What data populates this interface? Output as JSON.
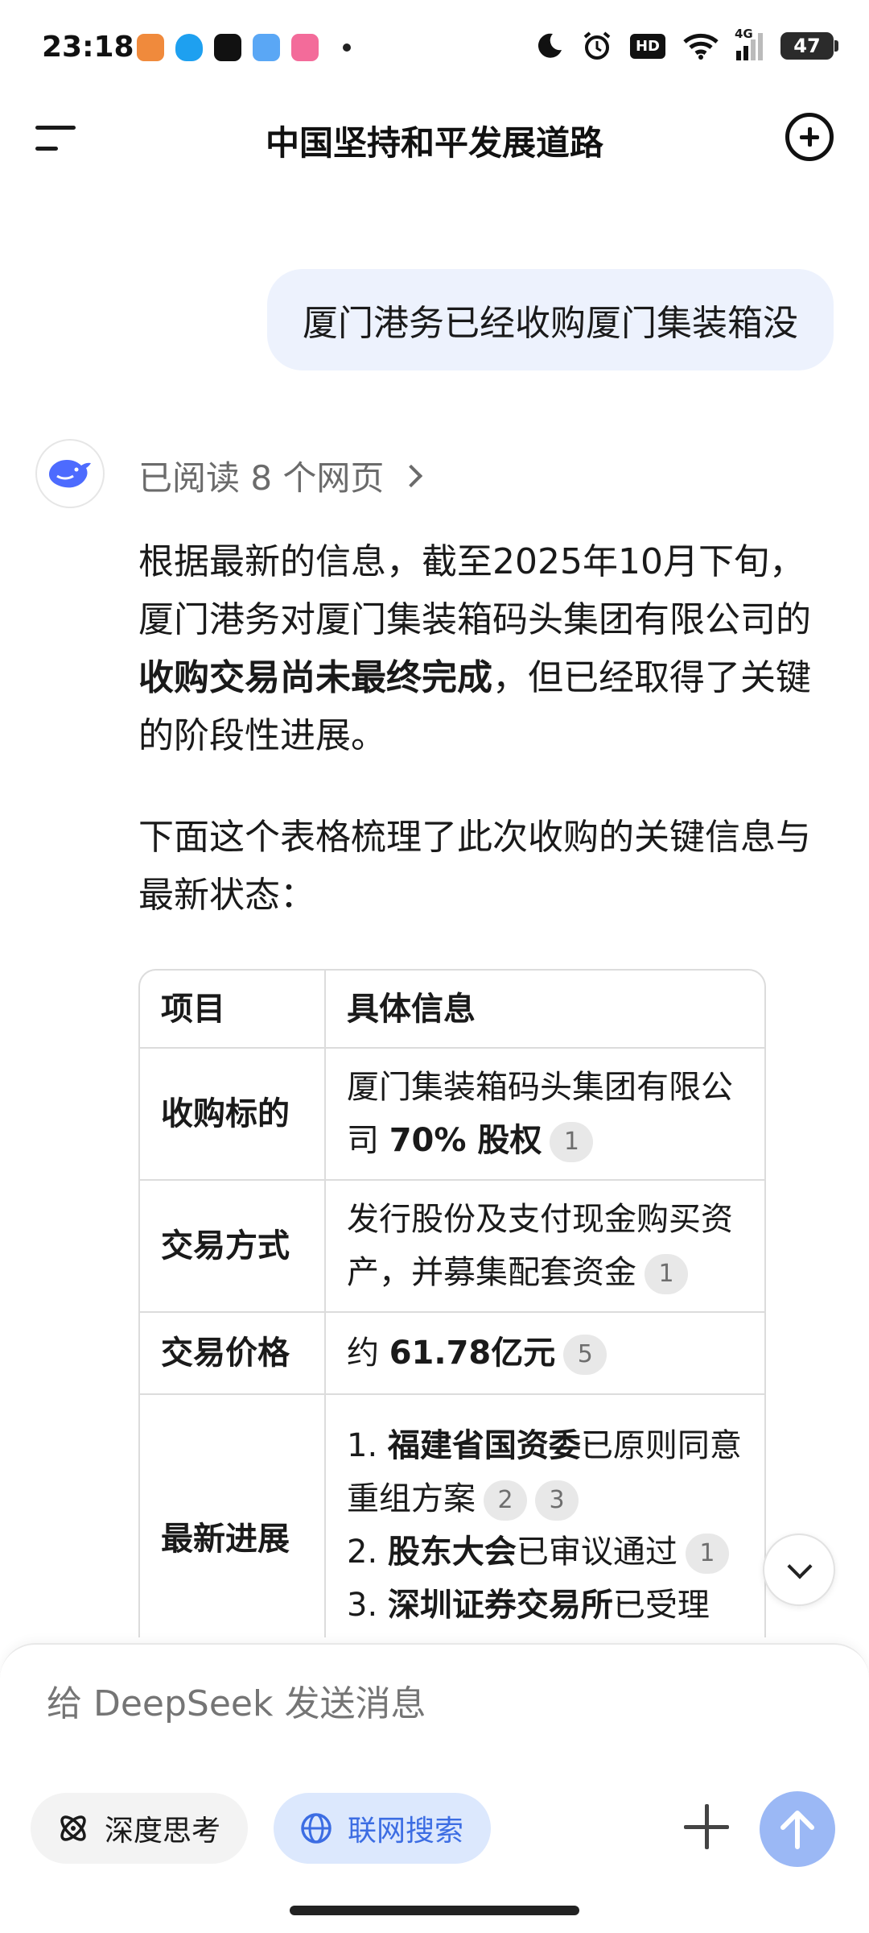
{
  "status_bar": {
    "time": "23:18",
    "battery": "47",
    "network": "4G",
    "icons": [
      "game-app-icon",
      "qq-icon",
      "tiktok-icon",
      "weather-icon",
      "bilibili-icon",
      "moon-icon",
      "alarm-icon",
      "hd-icon",
      "wifi-icon",
      "signal-icon",
      "battery-icon"
    ],
    "hd": "HD"
  },
  "header": {
    "title": "中国坚持和平发展道路"
  },
  "user_message": "厦门港务已经收购厦门集装箱没",
  "assistant": {
    "read_pages": "已阅读 8 个网页",
    "para1_a": "根据最新的信息，截至2025年10月下旬，厦门港务对厦门集装箱码头集团有限公司的",
    "para1_bold": "收购交易尚未最终完成",
    "para1_b": "，但已经取得了关键的阶段性进展。",
    "para2": "下面这个表格梳理了此次收购的关键信息与最新状态：",
    "table": {
      "header": [
        "项目",
        "具体信息"
      ],
      "row1_label": "收购标的",
      "row1_text": "厦门集装箱码头集团有限公司 ",
      "row1_bold": "70% 股权",
      "row1_ref": "1",
      "row2_label": "交易方式",
      "row2_text": "发行股份及支付现金购买资产，并募集配套资金",
      "row2_ref": "1",
      "row3_label": "交易价格",
      "row3_text": "约 ",
      "row3_bold": "61.78亿元",
      "row3_ref": "5",
      "row4_label": "最新进展",
      "row4_item1_num": "1. ",
      "row4_item1_bold": "福建省国资委",
      "row4_item1_text": "已原则同意重组方案",
      "row4_item1_refs": [
        "2",
        "3"
      ],
      "row4_item2_num": "2. ",
      "row4_item2_bold": "股东大会",
      "row4_item2_text": "已审议通过",
      "row4_item2_ref": "1",
      "row4_item3_num": "3. ",
      "row4_item3_bold": "深圳证券交易所",
      "row4_item3_text": "已受理"
    }
  },
  "composer": {
    "placeholder": "给 DeepSeek 发送消息",
    "deep_think": "深度思考",
    "web_search": "联网搜索"
  },
  "colors": {
    "accent": "#3c6de3",
    "user_bubble": "#edf2fd",
    "send_button": "#9bb8f5"
  }
}
